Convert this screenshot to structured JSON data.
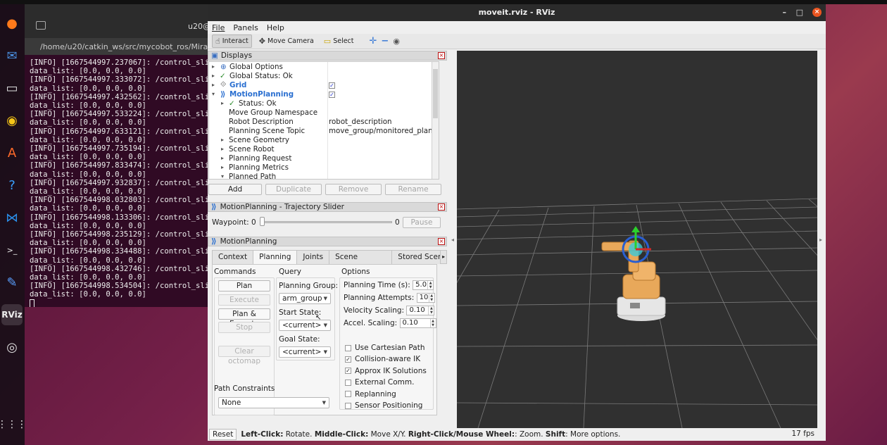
{
  "terminal": {
    "title": "u20@",
    "path": "/home/u20/catkin_ws/src/mycobot_ros/Mira...",
    "lines": [
      "[INFO] [1667544997.237067]: /control_slid",
      "data_list: [0.0, 0.0, 0.0]",
      "[INFO] [1667544997.333072]: /control_slid",
      "data_list: [0.0, 0.0, 0.0]",
      "[INFO] [1667544997.432562]: /control_slid",
      "data_list: [0.0, 0.0, 0.0]",
      "[INFO] [1667544997.533224]: /control_slid",
      "data_list: [0.0, 0.0, 0.0]",
      "[INFO] [1667544997.633121]: /control_slid",
      "data_list: [0.0, 0.0, 0.0]",
      "[INFO] [1667544997.735194]: /control_slid",
      "data_list: [0.0, 0.0, 0.0]",
      "[INFO] [1667544997.833474]: /control_slid",
      "data_list: [0.0, 0.0, 0.0]",
      "[INFO] [1667544997.932837]: /control_slid",
      "data_list: [0.0, 0.0, 0.0]",
      "[INFO] [1667544998.032803]: /control_slid",
      "data_list: [0.0, 0.0, 0.0]",
      "[INFO] [1667544998.133306]: /control_slid",
      "data_list: [0.0, 0.0, 0.0]",
      "[INFO] [1667544998.235129]: /control_slid",
      "data_list: [0.0, 0.0, 0.0]",
      "[INFO] [1667544998.334488]: /control_slid",
      "data_list: [0.0, 0.0, 0.0]",
      "[INFO] [1667544998.432746]: /control_slid",
      "data_list: [0.0, 0.0, 0.0]",
      "[INFO] [1667544998.534504]: /control_slid",
      "data_list: [0.0, 0.0, 0.0]"
    ]
  },
  "window": {
    "title": "moveit.rviz - RViz",
    "minimize": "–",
    "maximize": "□",
    "close": "×"
  },
  "menu": {
    "file": "File",
    "panels": "Panels",
    "help": "Help"
  },
  "toolbar": {
    "interact": "Interact",
    "move_camera": "Move Camera",
    "select": "Select"
  },
  "displays": {
    "title": "Displays",
    "rows": [
      {
        "name": "Global Options",
        "value": ""
      },
      {
        "name": "Global Status: Ok",
        "value": ""
      },
      {
        "name": "Grid",
        "value": ""
      },
      {
        "name": "MotionPlanning",
        "value": ""
      },
      {
        "name": "Status: Ok",
        "value": ""
      },
      {
        "name": "Move Group Namespace",
        "value": ""
      },
      {
        "name": "Robot Description",
        "value": "robot_description"
      },
      {
        "name": "Planning Scene Topic",
        "value": "move_group/monitored_planni…"
      },
      {
        "name": "Scene Geometry",
        "value": ""
      },
      {
        "name": "Scene Robot",
        "value": ""
      },
      {
        "name": "Planning Request",
        "value": ""
      },
      {
        "name": "Planning Metrics",
        "value": ""
      },
      {
        "name": "Planned Path",
        "value": ""
      }
    ],
    "buttons": {
      "add": "Add",
      "duplicate": "Duplicate",
      "remove": "Remove",
      "rename": "Rename"
    }
  },
  "trajectory": {
    "title": "MotionPlanning - Trajectory Slider",
    "waypoint_label": "Waypoint: 0",
    "max_value": "0",
    "pause": "Pause",
    "slider_fraction": 0
  },
  "motion_planning": {
    "title": "MotionPlanning",
    "tabs": [
      "Context",
      "Planning",
      "Joints",
      "Scene Objects",
      "Stored Scene"
    ],
    "active_tab": "Planning",
    "commands": {
      "title": "Commands",
      "plan": "Plan",
      "execute": "Execute",
      "plan_execute": "Plan & Execute",
      "stop": "Stop",
      "clear_octomap": "Clear octomap"
    },
    "query": {
      "title": "Query",
      "planning_group_label": "Planning Group:",
      "planning_group": "arm_group",
      "start_state_label": "Start State:",
      "start_state": "<current>",
      "goal_state_label": "Goal State:",
      "goal_state": "<current>"
    },
    "options": {
      "title": "Options",
      "planning_time_label": "Planning Time (s):",
      "planning_time": "5.0",
      "planning_attempts_label": "Planning Attempts:",
      "planning_attempts": "10",
      "velocity_label": "Velocity Scaling:",
      "velocity": "0.10",
      "accel_label": "Accel. Scaling:",
      "accel": "0.10",
      "checkboxes": [
        {
          "label": "Use Cartesian Path",
          "checked": false
        },
        {
          "label": "Collision-aware IK",
          "checked": true
        },
        {
          "label": "Approx IK Solutions",
          "checked": true
        },
        {
          "label": "External Comm.",
          "checked": false
        },
        {
          "label": "Replanning",
          "checked": false
        },
        {
          "label": "Sensor Positioning",
          "checked": false
        }
      ]
    },
    "path_constraints": {
      "title": "Path Constraints",
      "value": "None"
    }
  },
  "status": {
    "reset": "Reset",
    "left_click": "Left-Click:",
    "left_click_action": " Rotate. ",
    "middle_click": "Middle-Click:",
    "middle_click_action": " Move X/Y. ",
    "right_click": "Right-Click/Mouse Wheel:",
    "right_click_action": ": Zoom. ",
    "shift": "Shift",
    "shift_action": ": More options.",
    "fps": "17 fps"
  }
}
